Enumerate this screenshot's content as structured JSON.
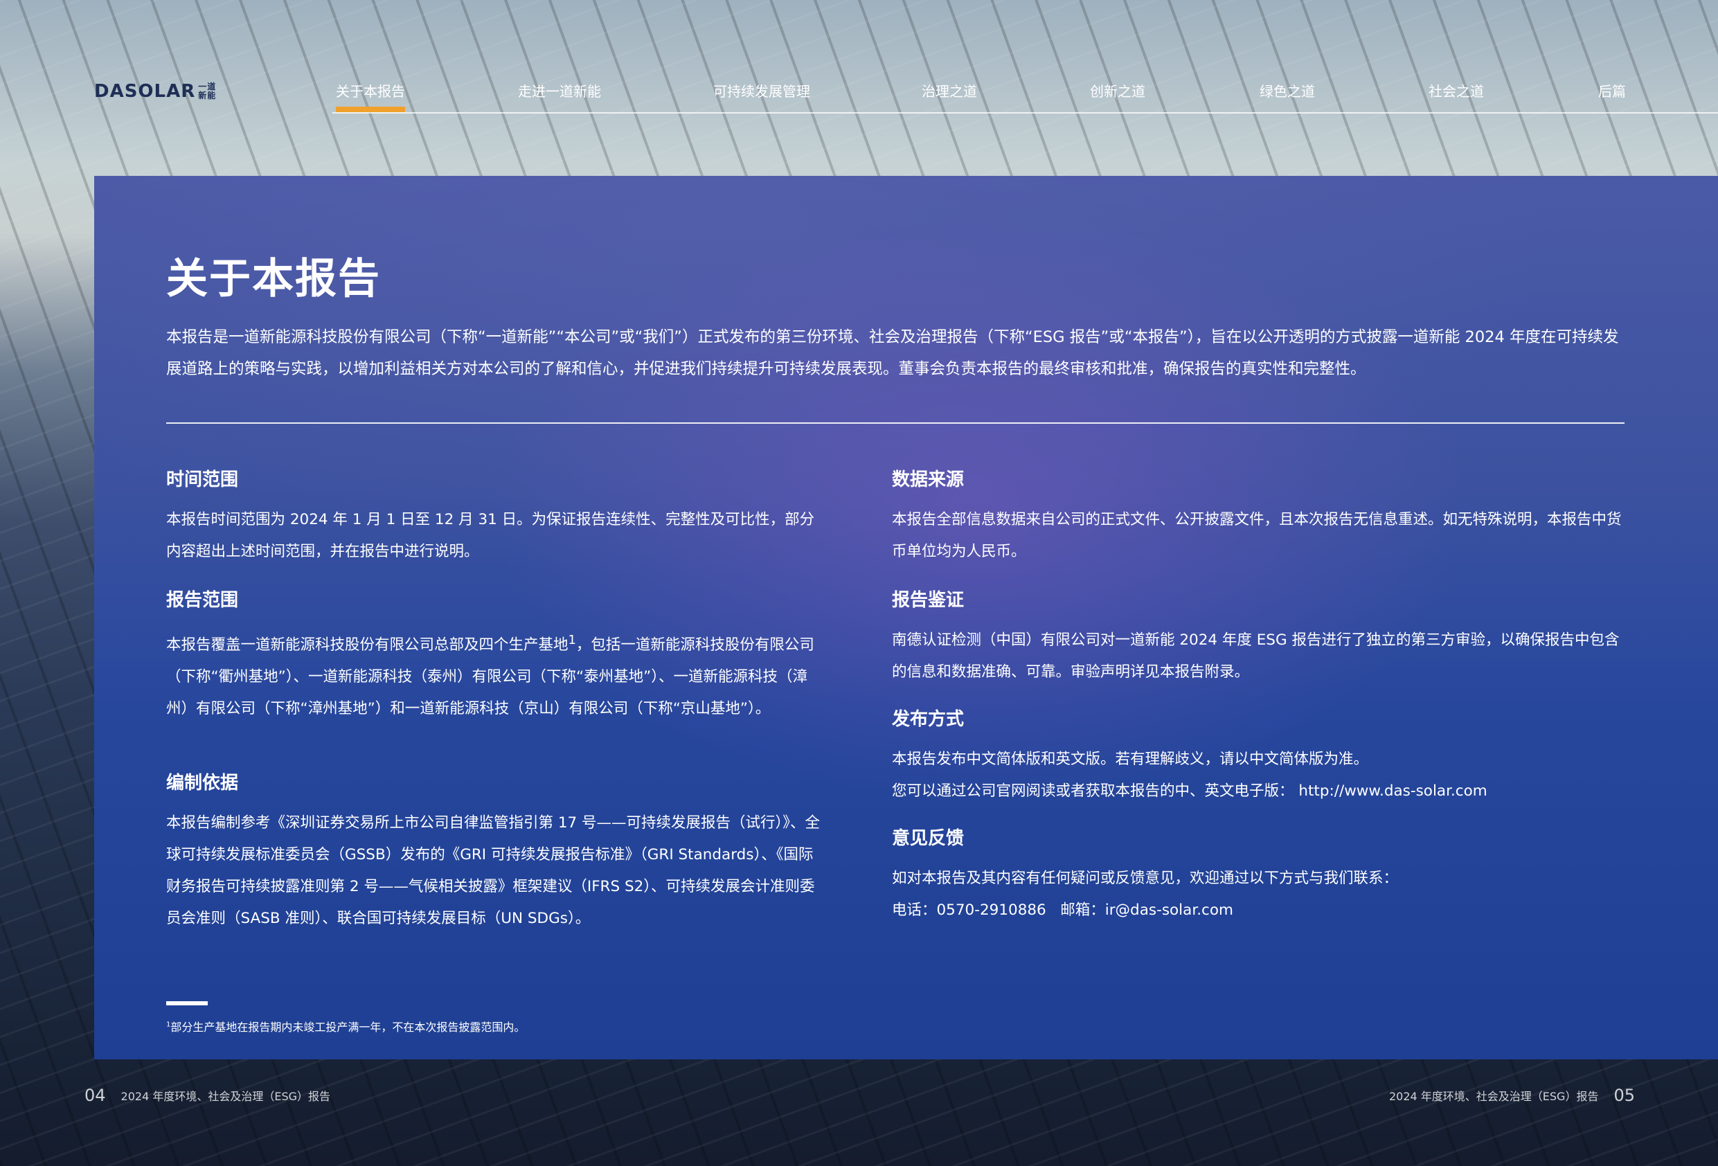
{
  "brand": {
    "logo_text": "DASOLAR",
    "logo_cn_1": "一道",
    "logo_cn_2": "新能"
  },
  "nav": {
    "items": [
      {
        "label": "关于本报告",
        "active": true
      },
      {
        "label": "走进一道新能"
      },
      {
        "label": "可持续发展管理"
      },
      {
        "label": "治理之道"
      },
      {
        "label": "创新之道"
      },
      {
        "label": "绿色之道"
      },
      {
        "label": "社会之道"
      },
      {
        "label": "后篇"
      }
    ],
    "active_color": "#f0a12d"
  },
  "page": {
    "title": "关于本报告",
    "intro": "本报告是一道新能源科技股份有限公司（下称“一道新能”“本公司”或“我们”）正式发布的第三份环境、社会及治理报告（下称“ESG 报告”或“本报告”），旨在以公开透明的方式披露一道新能 2024 年度在可持续发展道路上的策略与实践，以增加利益相关方对本公司的了解和信心，并促进我们持续提升可持续发展表现。董事会负责本报告的最终审核和批准，确保报告的真实性和完整性。"
  },
  "sections": {
    "time_scope": {
      "title": "时间范围",
      "body": "本报告时间范围为 2024 年 1 月 1 日至 12 月 31 日。为保证报告连续性、完整性及可比性，部分内容超出上述时间范围，并在报告中进行说明。"
    },
    "report_scope": {
      "title": "报告范围",
      "body_before": "本报告覆盖一道新能源科技股份有限公司总部及四个生产基地",
      "footnote_ref": "1",
      "body_after": "，包括一道新能源科技股份有限公司（下称“衢州基地”）、一道新能源科技（泰州）有限公司（下称“泰州基地”）、一道新能源科技（漳州）有限公司（下称“漳州基地”）和一道新能源科技（京山）有限公司（下称“京山基地”）。"
    },
    "basis": {
      "title": "编制依据",
      "body": "本报告编制参考《深圳证券交易所上市公司自律监管指引第 17 号——可持续发展报告（试行）》、全球可持续发展标准委员会（GSSB）发布的《GRI 可持续发展报告标准》（GRI Standards）、《国际财务报告可持续披露准则第 2 号——气候相关披露》框架建议（IFRS S2）、可持续发展会计准则委员会准则（SASB 准则）、联合国可持续发展目标（UN SDGs）。"
    },
    "data_source": {
      "title": "数据来源",
      "body": "本报告全部信息数据来自公司的正式文件、公开披露文件，且本次报告无信息重述。如无特殊说明，本报告中货币单位均为人民币。"
    },
    "assurance": {
      "title": "报告鉴证",
      "body": "南德认证检测（中国）有限公司对一道新能 2024 年度 ESG 报告进行了独立的第三方审验，以确保报告中包含的信息和数据准确、可靠。审验声明详见本报告附录。"
    },
    "publication": {
      "title": "发布方式",
      "line1": "本报告发布中文简体版和英文版。若有理解歧义，请以中文简体版为准。",
      "line2": "您可以通过公司官网阅读或者获取本报告的中、英文电子版： http://www.das-solar.com"
    },
    "feedback": {
      "title": "意见反馈",
      "line1": "如对本报告及其内容有任何疑问或反馈意见，欢迎通过以下方式与我们联系：",
      "line2": "电话：0570-2910886   邮箱：ir@das-solar.com"
    }
  },
  "footnote": {
    "marker": "1",
    "text": "部分生产基地在报告期内未竣工投产满一年，不在本次报告披露范围内。"
  },
  "footer": {
    "left_page": "04",
    "left_title": "2024 年度环境、社会及治理（ESG）报告",
    "right_title": "2024 年度环境、社会及治理（ESG）报告",
    "right_page": "05"
  }
}
